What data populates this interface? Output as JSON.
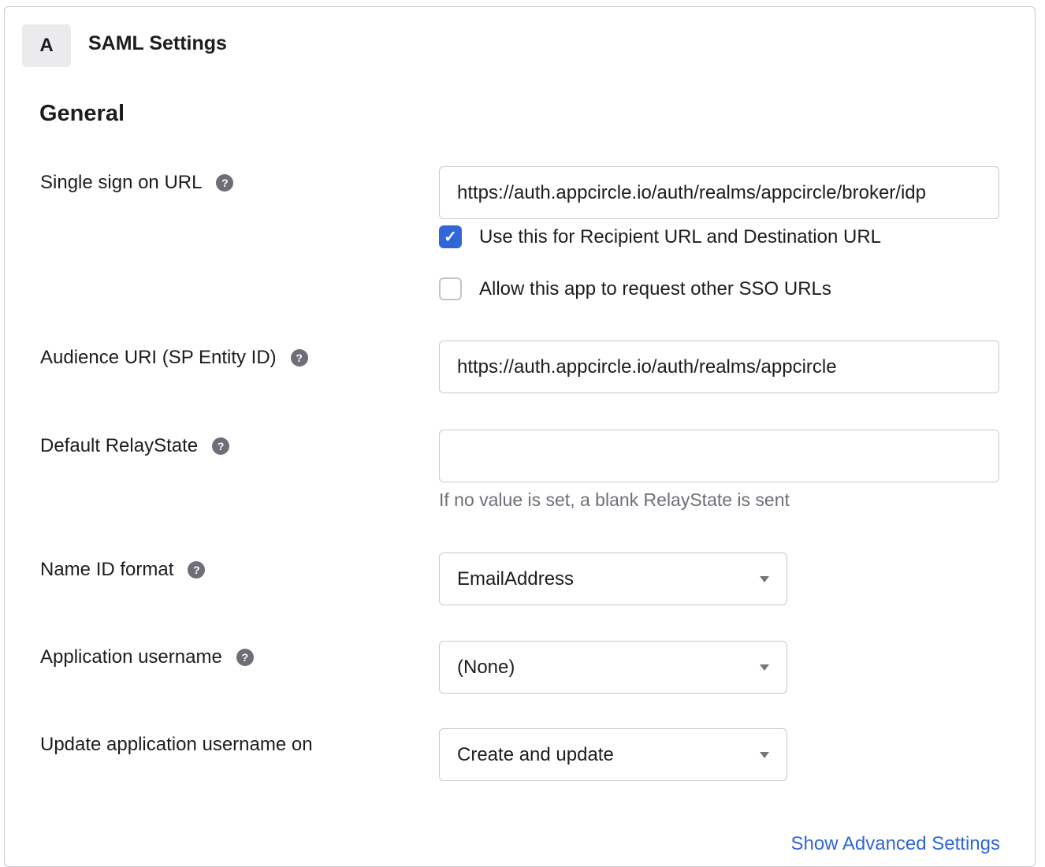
{
  "header": {
    "step": "A",
    "title": "SAML Settings"
  },
  "section": "General",
  "fields": {
    "sso_url": {
      "label": "Single sign on URL",
      "value": "https://auth.appcircle.io/auth/realms/appcircle/broker/idp"
    },
    "recipient_checkbox": {
      "label": "Use this for Recipient URL and Destination URL",
      "checked": true
    },
    "other_sso_checkbox": {
      "label": "Allow this app to request other SSO URLs",
      "checked": false
    },
    "audience_uri": {
      "label": "Audience URI (SP Entity ID)",
      "value": "https://auth.appcircle.io/auth/realms/appcircle"
    },
    "relay_state": {
      "label": "Default RelayState",
      "value": "",
      "hint": "If no value is set, a blank RelayState is sent"
    },
    "name_id_format": {
      "label": "Name ID format",
      "value": "EmailAddress"
    },
    "app_username": {
      "label": "Application username",
      "value": "(None)"
    },
    "update_username_on": {
      "label": "Update application username on",
      "value": "Create and update"
    }
  },
  "help_glyph": "?",
  "check_glyph": "✓",
  "advanced_link": "Show Advanced Settings"
}
